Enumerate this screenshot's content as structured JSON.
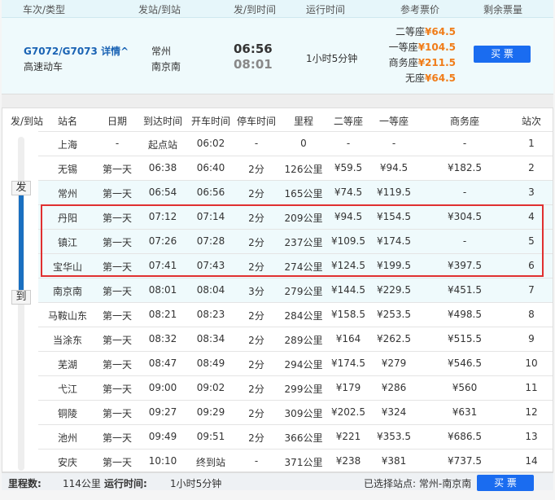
{
  "header": {
    "cols": [
      "车次/类型",
      "发站/到站",
      "发/到时间",
      "运行时间",
      "参考票价",
      "剩余票量"
    ]
  },
  "train": {
    "number": "G7072/G7073",
    "detail": "详情",
    "type": "高速动车",
    "from": "常州",
    "to": "南京南",
    "depart": "06:56",
    "arrive": "08:01",
    "duration": "1小时5分钟",
    "prices": [
      {
        "label": "二等座",
        "price": "¥64.5"
      },
      {
        "label": "一等座",
        "price": "¥104.5"
      },
      {
        "label": "商务座",
        "price": "¥211.5"
      },
      {
        "label": "无座",
        "price": "¥64.5"
      }
    ],
    "buy": "买 票"
  },
  "table": {
    "headers": [
      "发/到站",
      "站名",
      "日期",
      "到达时间",
      "开车时间",
      "停车时间",
      "里程",
      "二等座",
      "一等座",
      "商务座",
      "站次"
    ],
    "depart_tag": "发",
    "arrive_tag": "到",
    "rows": [
      [
        "上海",
        "-",
        "起点站",
        "06:02",
        "-",
        "0",
        "-",
        "-",
        "-",
        "1"
      ],
      [
        "无锡",
        "第一天",
        "06:38",
        "06:40",
        "2分",
        "126公里",
        "¥59.5",
        "¥94.5",
        "¥182.5",
        "2"
      ],
      [
        "常州",
        "第一天",
        "06:54",
        "06:56",
        "2分",
        "165公里",
        "¥74.5",
        "¥119.5",
        "-",
        "3"
      ],
      [
        "丹阳",
        "第一天",
        "07:12",
        "07:14",
        "2分",
        "209公里",
        "¥94.5",
        "¥154.5",
        "¥304.5",
        "4"
      ],
      [
        "镇江",
        "第一天",
        "07:26",
        "07:28",
        "2分",
        "237公里",
        "¥109.5",
        "¥174.5",
        "-",
        "5"
      ],
      [
        "宝华山",
        "第一天",
        "07:41",
        "07:43",
        "2分",
        "274公里",
        "¥124.5",
        "¥199.5",
        "¥397.5",
        "6"
      ],
      [
        "南京南",
        "第一天",
        "08:01",
        "08:04",
        "3分",
        "279公里",
        "¥144.5",
        "¥229.5",
        "¥451.5",
        "7"
      ],
      [
        "马鞍山东",
        "第一天",
        "08:21",
        "08:23",
        "2分",
        "284公里",
        "¥158.5",
        "¥253.5",
        "¥498.5",
        "8"
      ],
      [
        "当涂东",
        "第一天",
        "08:32",
        "08:34",
        "2分",
        "289公里",
        "¥164",
        "¥262.5",
        "¥515.5",
        "9"
      ],
      [
        "芜湖",
        "第一天",
        "08:47",
        "08:49",
        "2分",
        "294公里",
        "¥174.5",
        "¥279",
        "¥546.5",
        "10"
      ],
      [
        "弋江",
        "第一天",
        "09:00",
        "09:02",
        "2分",
        "299公里",
        "¥179",
        "¥286",
        "¥560",
        "11"
      ],
      [
        "铜陵",
        "第一天",
        "09:27",
        "09:29",
        "2分",
        "309公里",
        "¥202.5",
        "¥324",
        "¥631",
        "12"
      ],
      [
        "池州",
        "第一天",
        "09:49",
        "09:51",
        "2分",
        "366公里",
        "¥221",
        "¥353.5",
        "¥686.5",
        "13"
      ],
      [
        "安庆",
        "第一天",
        "10:10",
        "终到站",
        "-",
        "371公里",
        "¥238",
        "¥381",
        "¥737.5",
        "14"
      ]
    ]
  },
  "footer": {
    "mileage_label": "里程数:",
    "mileage": "114公里",
    "duration_label": "运行时间:",
    "duration": "1小时5分钟",
    "selected": "已选择站点: 常州-南京南",
    "buy": "买 票"
  }
}
